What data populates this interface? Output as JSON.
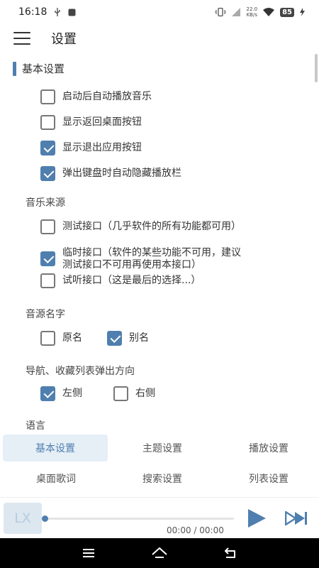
{
  "status_bar": {
    "time": "16:18",
    "net_speed_value": "22.0",
    "net_speed_unit": "KB/s",
    "battery": "85"
  },
  "app_bar": {
    "icon": "menu-icon",
    "title": "设置"
  },
  "settings": {
    "section_title": "基本设置",
    "basic_items": [
      {
        "label": "启动后自动播放音乐",
        "checked": false
      },
      {
        "label": "显示返回桌面按钮",
        "checked": false
      },
      {
        "label": "显示退出应用按钮",
        "checked": true
      },
      {
        "label": "弹出键盘时自动隐藏播放栏",
        "checked": true
      }
    ],
    "music_source": {
      "title": "音乐来源",
      "options": [
        {
          "label": "测试接口（几乎软件的所有功能都可用）",
          "checked": false
        },
        {
          "label_line1": "临时接口（软件的某些功能不可用，建议",
          "label_line2": "测试接口不可用再使用本接口）",
          "checked": true
        },
        {
          "label": "试听接口（这是最后的选择...）",
          "checked": false
        }
      ]
    },
    "source_name": {
      "title": "音源名字",
      "options": [
        {
          "label": "原名",
          "checked": false
        },
        {
          "label": "别名",
          "checked": true
        }
      ]
    },
    "nav_direction": {
      "title": "导航、收藏列表弹出方向",
      "options": [
        {
          "label": "左侧",
          "checked": true
        },
        {
          "label": "右侧",
          "checked": false
        }
      ]
    },
    "language": {
      "title": "语言"
    }
  },
  "tabs": [
    {
      "label": "基本设置",
      "active": true
    },
    {
      "label": "主题设置",
      "active": false
    },
    {
      "label": "播放设置",
      "active": false
    },
    {
      "label": "桌面歌词",
      "active": false
    },
    {
      "label": "搜索设置",
      "active": false
    },
    {
      "label": "列表设置",
      "active": false
    }
  ],
  "player": {
    "logo_text": "LX",
    "time": "00:00 / 00:00",
    "progress": 0
  },
  "colors": {
    "accent": "#4f7fae",
    "active_tab_bg": "#e6eef6"
  }
}
